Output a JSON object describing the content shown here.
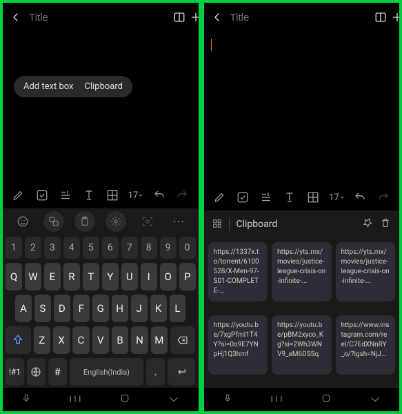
{
  "header": {
    "title_placeholder": "Title"
  },
  "pills": {
    "add_text_box": "Add text box",
    "clipboard": "Clipboard"
  },
  "toolbar": {
    "font_size": "17"
  },
  "keyboard": {
    "space_label": "English(India)",
    "sym_label": "!#1",
    "numbers": [
      "1",
      "2",
      "3",
      "4",
      "5",
      "6",
      "7",
      "8",
      "9",
      "0"
    ],
    "row1": [
      "Q",
      "W",
      "E",
      "R",
      "T",
      "Y",
      "U",
      "I",
      "O",
      "P"
    ],
    "row2": [
      "A",
      "S",
      "D",
      "F",
      "G",
      "H",
      "J",
      "K",
      "L"
    ],
    "row3": [
      "Z",
      "X",
      "C",
      "V",
      "B",
      "N",
      "M"
    ]
  },
  "clipboard_panel": {
    "label": "Clipboard",
    "items": [
      "https://1337x.to/torrent/6100528/X-Men-97-S01-COMPLETE-...",
      "https://yts.mx/movies/justice-league-crisis-on-infinite-...",
      "https://yts.mx/movies/justice-league-crisis-on-infinite-...",
      "https://youtu.be/7xgPfmI1T4Y?si=0o9E7YNpHj1Q3hmf",
      "https://youtu.be/pBM2xyco_Kg?si=2Wh3WNV9_eM6DSSq",
      "https://www.instagram.com/reel/C7EdXNnRY_o/?igsh=NjJ..."
    ]
  }
}
